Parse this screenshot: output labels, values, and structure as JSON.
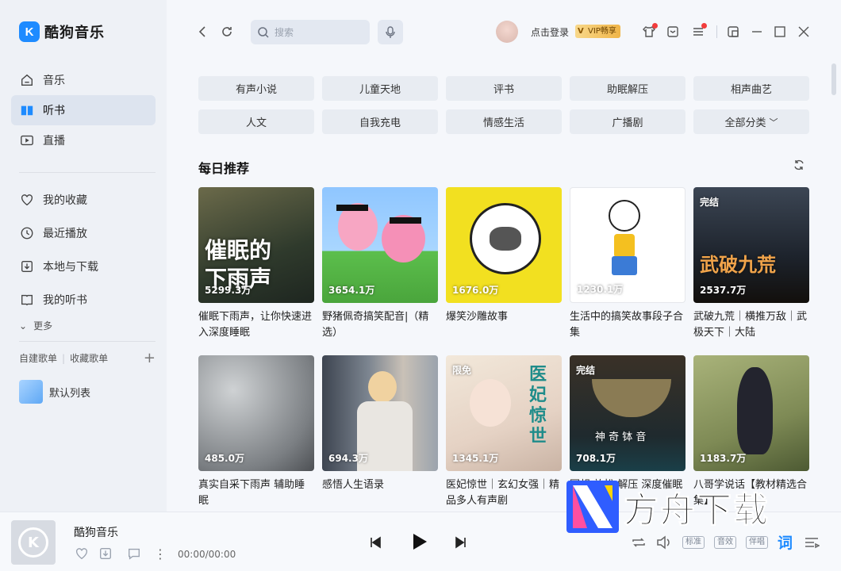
{
  "app": {
    "name": "酷狗音乐",
    "logo_letter": "K"
  },
  "sidebar": {
    "items": [
      {
        "label": "音乐",
        "icon": "home-icon"
      },
      {
        "label": "听书",
        "icon": "book-icon",
        "active": true
      },
      {
        "label": "直播",
        "icon": "live-icon"
      },
      {
        "label": "我的收藏",
        "icon": "heart-icon"
      },
      {
        "label": "最近播放",
        "icon": "clock-icon"
      },
      {
        "label": "本地与下载",
        "icon": "download-icon"
      },
      {
        "label": "我的听书",
        "icon": "bookmark-icon"
      }
    ],
    "more_label": "更多",
    "playlist_tabs": [
      "自建歌单",
      "收藏歌单"
    ],
    "add_symbol": "+",
    "default_list": "默认列表"
  },
  "topbar": {
    "search_placeholder": "搜索",
    "login_label": "点击登录",
    "vip_label": "VIP畅享"
  },
  "categories": [
    [
      "有声小说",
      "儿童天地",
      "评书",
      "助眠解压",
      "相声曲艺"
    ],
    [
      "人文",
      "自我充电",
      "情感生活",
      "广播剧",
      "全部分类"
    ]
  ],
  "section": {
    "title": "每日推荐"
  },
  "cards": [
    {
      "count": "5299.3万",
      "title": "催眠下雨声，让你快速进入深度睡眠",
      "cover_text": "催眠的\n下雨声"
    },
    {
      "count": "3654.1万",
      "title": "野猪佩奇搞笑配音|（精选）"
    },
    {
      "count": "1676.0万",
      "title": "爆笑沙雕故事"
    },
    {
      "count": "1230.1万",
      "title": "生活中的搞笑故事段子合集"
    },
    {
      "count": "2537.7万",
      "title": "武破九荒｜横推万敌｜武极天下｜大陆",
      "badge": "完结",
      "cover_text": "武破九荒"
    },
    {
      "count": "485.0万",
      "title": "真实自采下雨声 辅助睡眠"
    },
    {
      "count": "694.3万",
      "title": "感悟人生语录"
    },
    {
      "count": "1345.1万",
      "title": "医妃惊世｜玄幻女强｜精品多人有声剧",
      "badge": "限免",
      "cover_text": "医妃惊世"
    },
    {
      "count": "708.1万",
      "title": "冥想 放松 解压 深度催眠 颂钵音",
      "badge": "完结",
      "cover_text": "神 奇 钵 音"
    },
    {
      "count": "1183.7万",
      "title": "八哥学说话【教材精选合集】"
    }
  ],
  "player": {
    "song": "酷狗音乐",
    "time": "00:00/00:00",
    "tags": [
      "标准",
      "音效",
      "伴唱"
    ],
    "lyrics_label": "词"
  },
  "watermark": {
    "text": "方舟下载"
  },
  "colors": {
    "accent": "#1e8bff",
    "sidebar_bg": "#eef1f6",
    "main_bg": "#f5f7fb",
    "vip": "#f0b548"
  }
}
